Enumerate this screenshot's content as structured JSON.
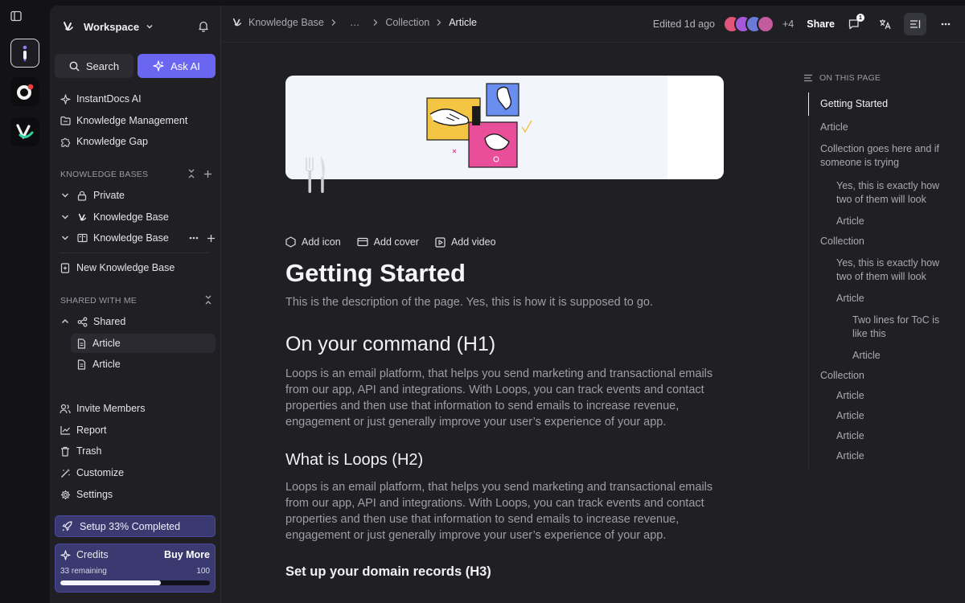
{
  "workspace": {
    "name": "Workspace"
  },
  "sidebar": {
    "search_label": "Search",
    "ask_ai_label": "Ask AI",
    "top_items": [
      {
        "label": "InstantDocs AI",
        "icon": "sparkle-icon"
      },
      {
        "label": "Knowledge Management",
        "icon": "folder-icon"
      },
      {
        "label": "Knowledge Gap",
        "icon": "puzzle-icon"
      }
    ],
    "kb_section_label": "KNOWLEDGE BASES",
    "kb_items": [
      {
        "label": "Private",
        "icon": "lock-icon"
      },
      {
        "label": "Knowledge Base",
        "icon": "brand-logo-icon"
      },
      {
        "label": "Knowledge Base",
        "icon": "book-icon"
      }
    ],
    "new_kb_label": "New Knowledge Base",
    "shared_section_label": "SHARED WITH ME",
    "shared_root_label": "Shared",
    "shared_items": [
      {
        "label": "Article",
        "selected": true
      },
      {
        "label": "Article",
        "selected": false
      }
    ],
    "bottom_items": [
      {
        "label": "Invite Members",
        "icon": "users-icon"
      },
      {
        "label": "Report",
        "icon": "chart-icon"
      },
      {
        "label": "Trash",
        "icon": "trash-icon"
      },
      {
        "label": "Customize",
        "icon": "wand-icon"
      },
      {
        "label": "Settings",
        "icon": "gear-icon"
      }
    ],
    "setup_label": "Setup 33% Completed",
    "credits": {
      "label": "Credits",
      "buy_label": "Buy More",
      "remaining_label": "33 remaining",
      "total_label": "100",
      "fraction_used": 0.67
    }
  },
  "topbar": {
    "breadcrumbs": [
      "Knowledge Base",
      "…",
      "Collection",
      "Article"
    ],
    "edited_label": "Edited 1d ago",
    "extra_avatars": "+4",
    "share_label": "Share",
    "comment_badge": "1",
    "avatar_colors": [
      "#e0567a",
      "#a45ad8",
      "#6a7ad8",
      "#c35b9c"
    ]
  },
  "page": {
    "actions": {
      "add_icon": "Add icon",
      "add_cover": "Add cover",
      "add_video": "Add video"
    },
    "title": "Getting Started",
    "description": "This is the description of the page. Yes, this is how it is supposed to go.",
    "h1": "On your command (H1)",
    "p1": "Loops is an email platform, that helps you send marketing and transactional emails from our app, API and integrations. With Loops, you can track events and contact properties and then use that information to send emails to increase revenue, engagement or just generally improve your user’s experience of your app.",
    "h2": "What is Loops (H2)",
    "p2": "Loops is an email platform, that helps you send marketing and transactional emails from our app, API and integrations. With Loops, you can track events and contact properties and then use that information to send emails to increase revenue, engagement or just generally improve your user’s experience of your app.",
    "h3": "Set up your domain records (H3)"
  },
  "toc": {
    "heading": "ON THIS PAGE",
    "items": [
      {
        "label": "Getting Started",
        "level": 0,
        "active": true
      },
      {
        "label": "Article",
        "level": 0
      },
      {
        "label": "Collection goes here and if someone is trying",
        "level": 0
      },
      {
        "label": "Yes, this is exactly how two of them will look",
        "level": 1
      },
      {
        "label": "Article",
        "level": 1
      },
      {
        "label": "Collection",
        "level": 0
      },
      {
        "label": "Yes, this is exactly how two of them will look",
        "level": 1
      },
      {
        "label": "Article",
        "level": 1
      },
      {
        "label": "Two lines for ToC is like this",
        "level": 2
      },
      {
        "label": "Article",
        "level": 2
      },
      {
        "label": "Collection",
        "level": 0
      },
      {
        "label": "Article",
        "level": 1
      },
      {
        "label": "Article",
        "level": 1
      },
      {
        "label": "Article",
        "level": 1
      },
      {
        "label": "Article",
        "level": 1
      }
    ]
  }
}
